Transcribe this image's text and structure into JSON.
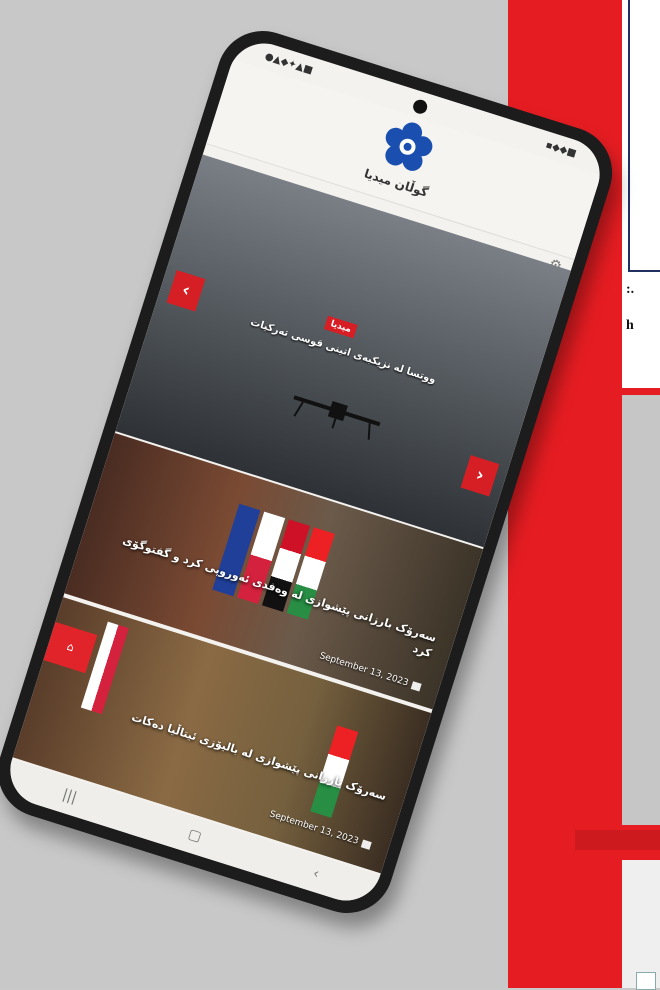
{
  "app": {
    "logo_text": "گوڵان میدیا",
    "status_left": "●▲◆✦▲■",
    "status_right": "▪◆◆■"
  },
  "slider": {
    "badge": "میدیا",
    "title": "ووتسا له نزیکبەی اتینی قوسی تەرکیات",
    "prev_icon": "‹",
    "next_icon": "›"
  },
  "posts": [
    {
      "title": "سەرۆک بارزانی پێشوازی لە وەفدی ئەوروپی کرد و گفتوگۆی کرد",
      "date": "September 13, 2023"
    },
    {
      "title": "سەرۆک بارزانی پێشوازی لە بالیۆزی ئیتاڵیا دەکات",
      "date": "September 13, 2023"
    }
  ],
  "background_text": {
    "line1": ":.",
    "line2": "h"
  },
  "nav": {
    "recent": "|||",
    "home": "▢",
    "back": "‹"
  },
  "colors": {
    "accent_red": "#e51d22",
    "phone_body": "#1c1c1c",
    "logo_blue": "#1a4fb0"
  }
}
